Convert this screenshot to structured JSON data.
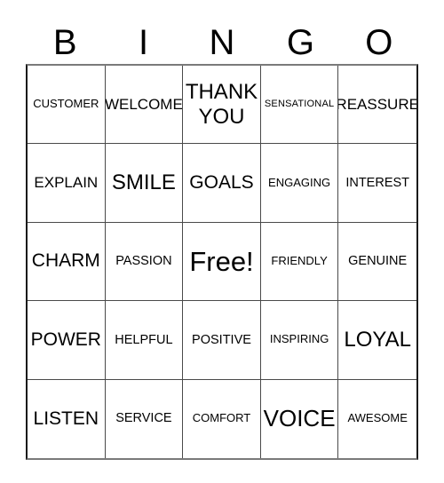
{
  "card": {
    "header_letters": [
      "B",
      "I",
      "N",
      "G",
      "O"
    ],
    "rows": [
      [
        {
          "text": "CUSTOMER",
          "size": "sz-s"
        },
        {
          "text": "WELCOME",
          "size": "sz-l"
        },
        {
          "text": "THANK YOU",
          "size": "sz-xxl"
        },
        {
          "text": "SENSATIONAL",
          "size": "sz-xs"
        },
        {
          "text": "REASSURE",
          "size": "sz-l"
        }
      ],
      [
        {
          "text": "EXPLAIN",
          "size": "sz-l"
        },
        {
          "text": "SMILE",
          "size": "sz-xxl"
        },
        {
          "text": "GOALS",
          "size": "sz-xl"
        },
        {
          "text": "ENGAGING",
          "size": "sz-s"
        },
        {
          "text": "INTEREST",
          "size": "sz-m"
        }
      ],
      [
        {
          "text": "CHARM",
          "size": "sz-xl"
        },
        {
          "text": "PASSION",
          "size": "sz-m"
        },
        {
          "text": "Free!",
          "size": "sz-free"
        },
        {
          "text": "FRIENDLY",
          "size": "sz-s"
        },
        {
          "text": "GENUINE",
          "size": "sz-m"
        }
      ],
      [
        {
          "text": "POWER",
          "size": "sz-xl"
        },
        {
          "text": "HELPFUL",
          "size": "sz-m"
        },
        {
          "text": "POSITIVE",
          "size": "sz-m"
        },
        {
          "text": "INSPIRING",
          "size": "sz-s"
        },
        {
          "text": "LOYAL",
          "size": "sz-xxl"
        }
      ],
      [
        {
          "text": "LISTEN",
          "size": "sz-xl"
        },
        {
          "text": "SERVICE",
          "size": "sz-m"
        },
        {
          "text": "COMFORT",
          "size": "sz-s"
        },
        {
          "text": "VOICE",
          "size": "sz-huge"
        },
        {
          "text": "AWESOME",
          "size": "sz-s"
        }
      ]
    ],
    "free_space": "Free!",
    "colors": {
      "background": "#ffffff",
      "text": "#000000",
      "outer_border": "#1a1a1a",
      "inner_border": "#4a4a4a"
    }
  }
}
